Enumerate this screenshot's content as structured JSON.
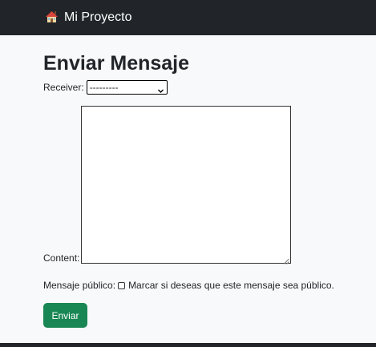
{
  "navbar": {
    "brand_label": "Mi Proyecto",
    "brand_icon": "house-icon",
    "background": "#212529"
  },
  "form": {
    "title": "Enviar Mensaje",
    "receiver_label": "Receiver:",
    "receiver_selected": "---------",
    "content_label": "Content:",
    "content_value": "",
    "public_label": "Mensaje público:",
    "public_checkbox_text": "Marcar si deseas que este mensaje sea público.",
    "public_checked": false,
    "submit_label": "Enviar",
    "submit_color": "#198754"
  }
}
